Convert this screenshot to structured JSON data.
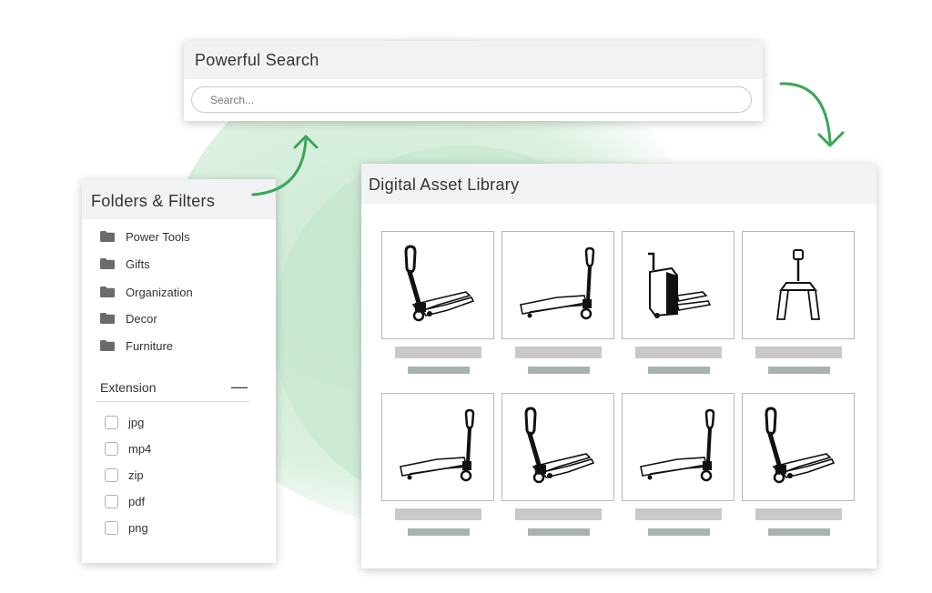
{
  "search": {
    "title": "Powerful Search",
    "placeholder": "Search..."
  },
  "folders": {
    "title": "Folders & Filters",
    "items": [
      {
        "label": "Power Tools",
        "icon": "folder-icon"
      },
      {
        "label": "Gifts",
        "icon": "folder-icon"
      },
      {
        "label": "Organization",
        "icon": "folder-icon"
      },
      {
        "label": "Decor",
        "icon": "folder-icon"
      },
      {
        "label": "Furniture",
        "icon": "folder-icon"
      }
    ]
  },
  "extension": {
    "title": "Extension",
    "collapse_symbol": "—",
    "options": [
      {
        "label": "jpg",
        "checked": false
      },
      {
        "label": "mp4",
        "checked": false
      },
      {
        "label": "zip",
        "checked": false
      },
      {
        "label": "pdf",
        "checked": false
      },
      {
        "label": "png",
        "checked": false
      }
    ]
  },
  "library": {
    "title": "Digital Asset Library",
    "assets": [
      {
        "icon": "pallet-jack-icon"
      },
      {
        "icon": "pallet-jack-icon"
      },
      {
        "icon": "electric-pallet-jack-icon"
      },
      {
        "icon": "pallet-jack-top-view-icon"
      },
      {
        "icon": "pallet-jack-icon"
      },
      {
        "icon": "pallet-jack-icon"
      },
      {
        "icon": "pallet-jack-icon"
      },
      {
        "icon": "pallet-jack-icon"
      }
    ]
  },
  "colors": {
    "accent_green": "#3aa657",
    "blob_green": "#cfeada",
    "header_gray": "#f1f2f4"
  }
}
